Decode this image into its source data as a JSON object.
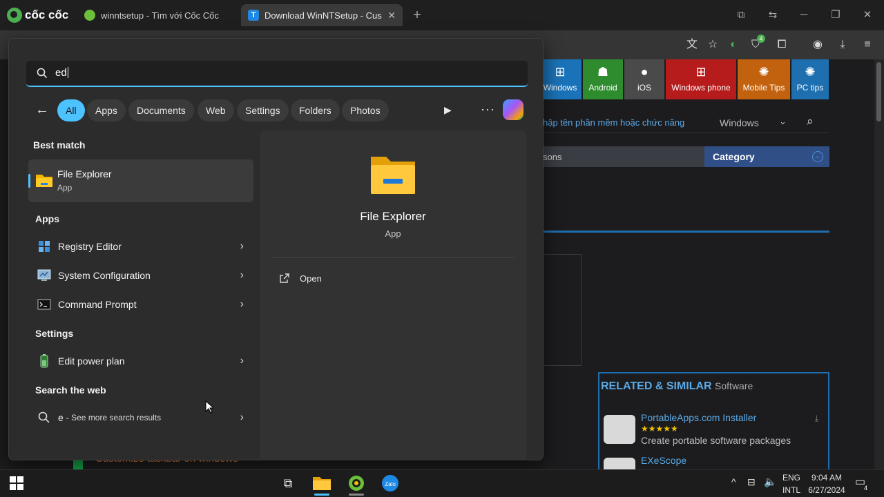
{
  "browser": {
    "brand": "cốc cốc",
    "tabs": [
      {
        "title": "winntsetup - Tìm với Cốc Cốc",
        "active": false
      },
      {
        "title": "Download WinNTSetup - Cus",
        "active": true
      }
    ],
    "new_tab_symbol": "+",
    "toolbar_icons": [
      "translate-icon",
      "star-icon",
      "moon-icon",
      "shield-icon",
      "extensions-icon",
      "profile-icon",
      "download-icon",
      "menu-icon"
    ],
    "shield_badge": "4"
  },
  "webpage": {
    "nav_tiles": [
      {
        "label": "Windows",
        "color": "#1a73b8"
      },
      {
        "label": "Android",
        "color": "#2e8b2e"
      },
      {
        "label": "iOS",
        "color": "#4a4a4a"
      },
      {
        "label": "Windows phone",
        "color": "#b71c1c"
      },
      {
        "label": "Mobile Tips",
        "color": "#c2620e"
      },
      {
        "label": "PC tips",
        "color": "#1e6fb0"
      }
    ],
    "search_placeholder_fragment": "hập tên phần mềm hoặc chức năng",
    "platform_select": "Windows",
    "tabs_fragment": "sons",
    "category_label": "Category",
    "related_title": "RELATED & SIMILAR",
    "related_suffix": "Software",
    "related_items": [
      {
        "name": "PortableApps.com Installer",
        "stars": "★★★★★",
        "desc": "Create portable software packages"
      },
      {
        "name": "EXeScope",
        "stars": "",
        "desc": ""
      }
    ],
    "behind_text": "Customize taskbar on windows"
  },
  "start_menu": {
    "search_value": "ed",
    "filters": [
      "All",
      "Apps",
      "Documents",
      "Web",
      "Settings",
      "Folders",
      "Photos"
    ],
    "best_match_heading": "Best match",
    "best_match": {
      "name": "File Explorer",
      "type": "App"
    },
    "apps_heading": "Apps",
    "apps": [
      {
        "name": "Registry Editor",
        "icon": "registry-icon"
      },
      {
        "name": "System Configuration",
        "icon": "system-config-icon"
      },
      {
        "name": "Command Prompt",
        "icon": "cmd-icon"
      }
    ],
    "settings_heading": "Settings",
    "settings": [
      {
        "name": "Edit power plan",
        "icon": "battery-icon"
      }
    ],
    "web_heading": "Search the web",
    "web_query": "e",
    "web_suffix": "- See more search results",
    "detail": {
      "name": "File Explorer",
      "type": "App",
      "action": "Open"
    }
  },
  "taskbar": {
    "lang_top": "ENG",
    "lang_bottom": "INTL",
    "time": "9:04 AM",
    "date": "6/27/2024",
    "notification_count": "4",
    "pinned": [
      "task-view-icon",
      "file-explorer-icon",
      "coccoc-icon",
      "zalo-icon"
    ]
  },
  "colors": {
    "accent": "#4cc2ff",
    "menu_bg": "#2c2c2c",
    "taskbar_bg": "#1c1c1c"
  }
}
